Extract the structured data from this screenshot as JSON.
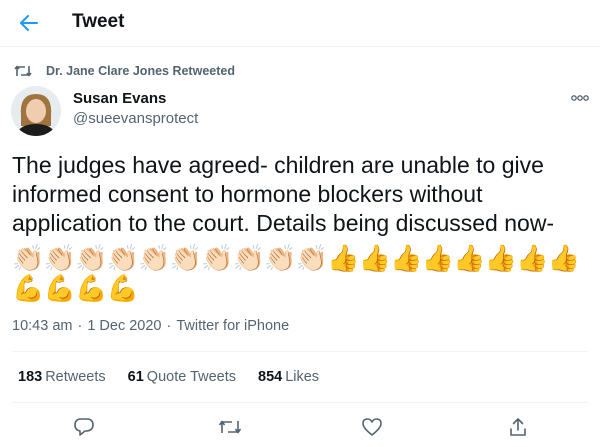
{
  "header": {
    "title": "Tweet"
  },
  "retweet": {
    "label": "Dr. Jane Clare Jones Retweeted"
  },
  "author": {
    "name": "Susan Evans",
    "handle": "@sueevansprotect"
  },
  "tweet": {
    "text": "The judges have agreed-  children are unable to give\ninformed consent to hormone blockers without\napplication to the court. Details being discussed now-",
    "emoji_line1": [
      "👏🏻",
      "👏🏻",
      "👏🏻",
      "👏🏻",
      "👏🏻",
      "👏🏻",
      "👏🏻",
      "👏🏻",
      "👏🏻",
      "👏🏻",
      "👍",
      "👍",
      "👍",
      "👍",
      "👍",
      "👍",
      "👍",
      "👍"
    ],
    "emoji_line2": [
      "💪",
      "💪",
      "💪",
      "💪"
    ]
  },
  "meta": {
    "time": "10:43 am",
    "date": "1 Dec 2020",
    "separator": "·",
    "source": "Twitter for iPhone"
  },
  "stats": {
    "retweets_count": "183",
    "retweets_label": "Retweets",
    "quotes_count": "61",
    "quotes_label": "Quote Tweets",
    "likes_count": "854",
    "likes_label": "Likes"
  },
  "colors": {
    "accent": "#1d9bf0",
    "secondary_text": "#536471",
    "divider": "#eff3f4"
  },
  "icons": [
    "back-arrow-icon",
    "retweet-icon",
    "more-icon",
    "reply-icon",
    "retweet-icon",
    "like-icon",
    "share-icon"
  ]
}
